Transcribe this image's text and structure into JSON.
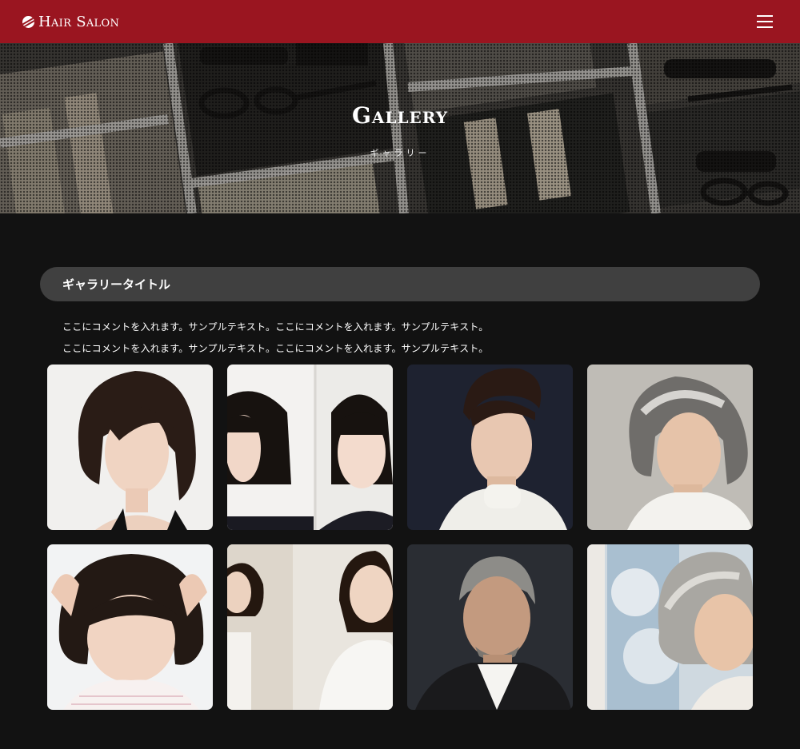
{
  "header": {
    "logo_text": "Hair Salon",
    "bg_color": "#9a1520"
  },
  "hero": {
    "title": "Gallery",
    "subtitle": "ギャラリー"
  },
  "section": {
    "title": "ギャラリータイトル",
    "comment_lines": [
      "ここにコメントを入れます。サンプルテキスト。ここにコメントを入れます。サンプルテキスト。",
      "ここにコメントを入れます。サンプルテキスト。ここにコメントを入れます。サンプルテキスト。"
    ]
  },
  "gallery": {
    "items": [
      {
        "subject": "woman-short-wavy-bob",
        "bg": "#f1f0ee",
        "hair": "#2a1c16"
      },
      {
        "subject": "woman-blunt-bob-split",
        "bg": "#f3f2f0",
        "hair": "#17120f"
      },
      {
        "subject": "man-swept-pompadour",
        "bg": "#1e2230",
        "hair": "#2a1a14"
      },
      {
        "subject": "woman-gray-curls",
        "bg": "#bfbcb6",
        "hair": "#6f6d6a"
      },
      {
        "subject": "child-round-bob",
        "bg": "#f2f3f4",
        "hair": "#231914"
      },
      {
        "subject": "woman-wavy-bob-mirror",
        "bg": "#e9e5de",
        "hair": "#24170f"
      },
      {
        "subject": "man-gray-short",
        "bg": "#2a2d33",
        "hair": "#8d8c88"
      },
      {
        "subject": "woman-silver-waves",
        "bg": "#cfd9e0",
        "hair": "#a9a7a2"
      }
    ]
  }
}
